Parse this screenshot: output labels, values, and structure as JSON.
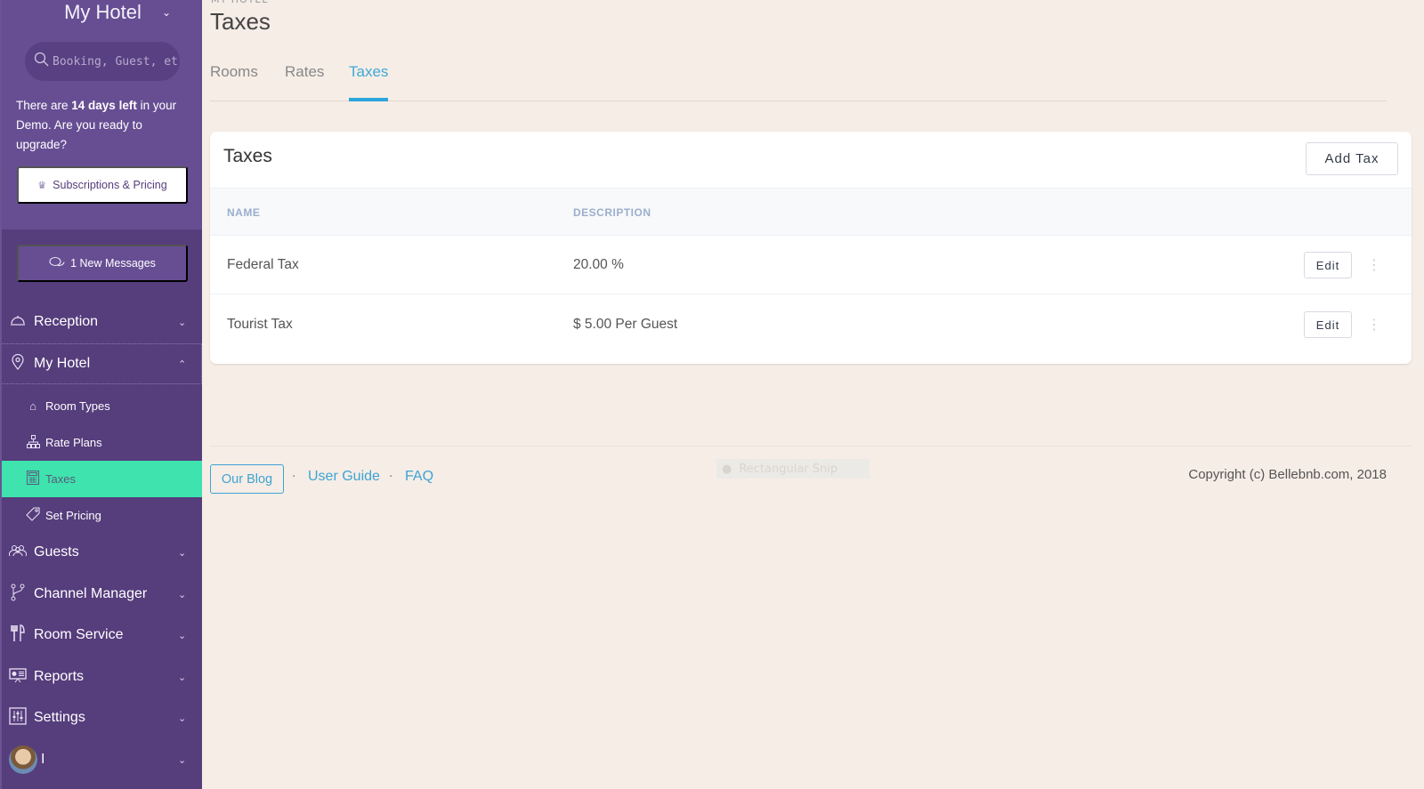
{
  "sidebar": {
    "hotel_name": "My Hotel",
    "search_placeholder": "Booking, Guest, etc",
    "demo_notice": {
      "prefix": "There are ",
      "bold": "14 days left",
      "suffix": " in your Demo. Are you ready to upgrade?"
    },
    "subscriptions_label": "Subscriptions & Pricing",
    "messages_label": "1 New Messages",
    "nav": [
      {
        "label": "Reception",
        "icon": "bell-icon"
      },
      {
        "label": "My Hotel",
        "icon": "map-pin-icon"
      },
      {
        "label": "Guests",
        "icon": "users-icon"
      },
      {
        "label": "Channel Manager",
        "icon": "git-branch-icon"
      },
      {
        "label": "Room Service",
        "icon": "utensils-icon"
      },
      {
        "label": "Reports",
        "icon": "presentation-icon"
      },
      {
        "label": "Settings",
        "icon": "sliders-icon"
      }
    ],
    "subnav": [
      {
        "label": "Room Types",
        "icon": "home-icon"
      },
      {
        "label": "Rate Plans",
        "icon": "sitemap-icon"
      },
      {
        "label": "Taxes",
        "icon": "calculator-icon",
        "active": true
      },
      {
        "label": "Set Pricing",
        "icon": "tag-icon"
      }
    ],
    "user_label": "I"
  },
  "main": {
    "breadcrumb": "MY HOTEL",
    "title": "Taxes",
    "tabs": [
      {
        "label": "Rooms"
      },
      {
        "label": "Rates"
      },
      {
        "label": "Taxes",
        "active": true
      }
    ],
    "card": {
      "title": "Taxes",
      "add_button": "Add Tax",
      "columns": [
        "NAME",
        "DESCRIPTION"
      ],
      "rows": [
        {
          "name": "Federal Tax",
          "description": "20.00 %",
          "edit_label": "Edit"
        },
        {
          "name": "Tourist Tax",
          "description": "$ 5.00 Per Guest",
          "edit_label": "Edit"
        }
      ]
    }
  },
  "footer": {
    "blog": "Our Blog",
    "separator": "·",
    "user_guide": "User Guide",
    "faq": "FAQ",
    "copyright": "Copyright (c) Bellebnb.com, 2018",
    "snip_overlay": "Rectangular Snip"
  },
  "colors": {
    "sidebar_bg": "#563d7c",
    "sidebar_top_bg": "#674e93",
    "active_item": "#3ee3ae",
    "accent": "#2ba6dc",
    "page_bg": "#f5ede6"
  }
}
